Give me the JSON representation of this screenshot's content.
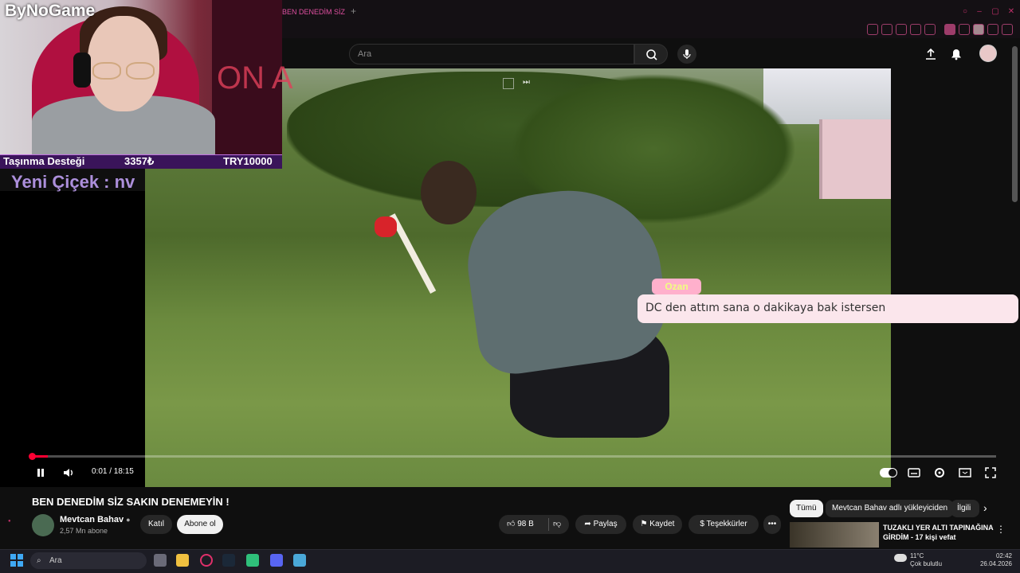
{
  "browser": {
    "tab_title": "BEN DENEDİM SİZ SAKIN",
    "new_tab_label": "+",
    "window_controls": [
      "minimize-icon",
      "maximize-icon",
      "close-icon"
    ],
    "extension_icons": [
      "pin-icon",
      "bookmark-icon",
      "shield-icon",
      "send-icon",
      "play-icon",
      "heart-icon",
      "extension-icon",
      "puzzle-icon",
      "profile-icon",
      "download-icon",
      "menu-icon"
    ]
  },
  "yt_header": {
    "search_placeholder": "Ara",
    "icons": [
      "search-icon",
      "mic-icon",
      "upload-icon",
      "bell-icon",
      "avatar"
    ]
  },
  "overlay": {
    "logo": "ByNoGame",
    "donation_label": "Taşınma Desteği",
    "donation_current": "3357₺",
    "donation_goal": "TRY10000",
    "new_flower": "Yeni Çiçek : nv",
    "background_text": "ON A",
    "chat_user": "Ozan",
    "chat_message": "DC den attım sana o dakikaya bak istersen"
  },
  "player": {
    "time": "0:01 / 18:15",
    "progress_fraction": 0.001,
    "controls": [
      "pause-icon",
      "volume-icon",
      "autoplay-toggle",
      "subtitles-icon",
      "settings-icon",
      "miniplayer-icon",
      "fullscreen-icon"
    ]
  },
  "video_info": {
    "title": "BEN DENEDİM SİZ SAKIN DENEMEYİN !",
    "channel_name": "Mevtcan Bahav",
    "subscribers": "2,57 Mn abone",
    "join_label": "Katıl",
    "subscribe_label": "Abone ol",
    "likes": "98 B",
    "share_label": "Paylaş",
    "save_label": "Kaydet",
    "thanks_label": "Teşekkürler",
    "more_label": "•••"
  },
  "recommendations": {
    "chips": [
      "Tümü",
      "Mevtcan Bahav adlı yükleyiciden",
      "İlgili"
    ],
    "items": [
      {
        "title": "TUZAKLI YER ALTI TAPINAĞINA GİRDİM - 17 kişi vefat"
      }
    ]
  },
  "taskbar": {
    "search_label": "Ara",
    "weather_temp": "11°C",
    "weather_desc": "Çok bulutlu",
    "time": "02:42",
    "date": "26.04.2026"
  },
  "colors": {
    "accent": "#ff0033",
    "donation_bar": "#3a145a",
    "chat_bubble": "#fbe6ec",
    "chat_tag": "#ffb0cc"
  }
}
